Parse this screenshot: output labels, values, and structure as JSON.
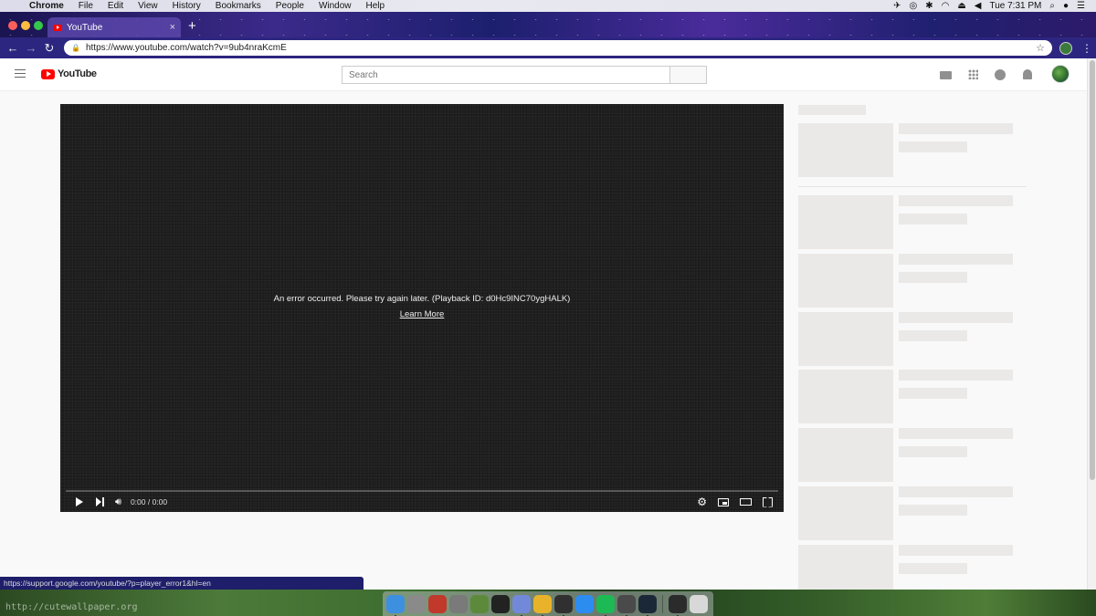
{
  "menubar": {
    "app": "Chrome",
    "items": [
      "File",
      "Edit",
      "View",
      "History",
      "Bookmarks",
      "People",
      "Window",
      "Help"
    ],
    "clock": "Tue 7:31 PM"
  },
  "browser": {
    "tab_title": "YouTube",
    "url": "https://www.youtube.com/watch?v=9ub4nraKcmE",
    "status_url": "https://support.google.com/youtube/?p=player_error1&hl=en"
  },
  "youtube": {
    "logo_text": "YouTube",
    "search_placeholder": "Search",
    "player": {
      "error_message": "An error occurred. Please try again later. (Playback ID: d0Hc9INC70ygHALK)",
      "learn_more": "Learn More",
      "time": "0:00 / 0:00",
      "progress": 0
    },
    "sidebar_placeholder_rows": 8
  },
  "desktop": {
    "watermark": "http://cutewallpaper.org"
  },
  "colors": {
    "youtube_red": "#ff0000",
    "player_bg": "#1f1f1f",
    "skeleton": "#ebe9e7"
  },
  "dock_icons": [
    {
      "name": "finder-icon",
      "color": "#3d8fe0"
    },
    {
      "name": "system-preferences-icon",
      "color": "#8a8a8a"
    },
    {
      "name": "photo-booth-icon",
      "color": "#c0392b"
    },
    {
      "name": "launchpad-icon",
      "color": "#7a7a7a"
    },
    {
      "name": "minecraft-icon",
      "color": "#5d8a3a"
    },
    {
      "name": "terminal-icon",
      "color": "#222222"
    },
    {
      "name": "discord-icon",
      "color": "#7289da"
    },
    {
      "name": "chrome-icon",
      "color": "#e8b32a"
    },
    {
      "name": "obs-icon",
      "color": "#303030"
    },
    {
      "name": "app-store-icon",
      "color": "#2d8cf0"
    },
    {
      "name": "spotify-icon",
      "color": "#1db954"
    },
    {
      "name": "steam-like-icon",
      "color": "#4a4a4a"
    },
    {
      "name": "steam-icon",
      "color": "#1b2838"
    },
    {
      "name": "activity-monitor-icon",
      "color": "#2b2b2b"
    },
    {
      "name": "trash-icon",
      "color": "#d8d8d8"
    }
  ]
}
